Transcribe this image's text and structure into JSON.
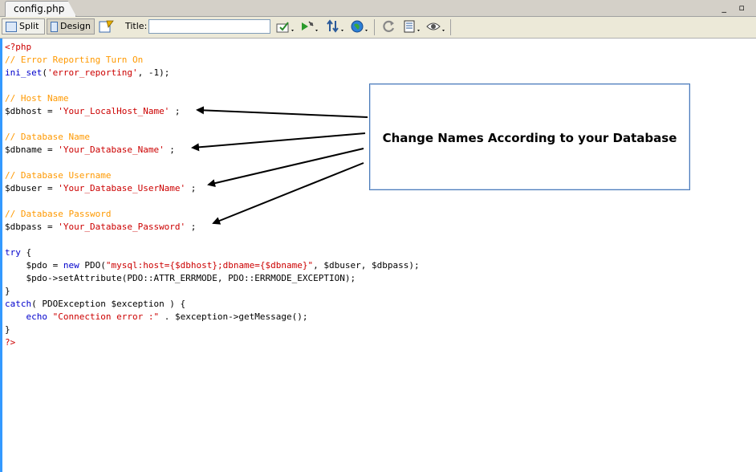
{
  "tab": {
    "label": "config.php"
  },
  "window_controls": "_ ▫",
  "toolbar": {
    "split_label": "Split",
    "design_label": "Design",
    "title_label": "Title:",
    "title_value": ""
  },
  "code_lines": [
    [
      {
        "t": "<?php",
        "c": "tag"
      }
    ],
    [
      {
        "t": "// Error Reporting Turn On",
        "c": "cmt"
      }
    ],
    [
      {
        "t": "ini_set",
        "c": "fn"
      },
      {
        "t": "(",
        "c": "plain"
      },
      {
        "t": "'error_reporting'",
        "c": "str"
      },
      {
        "t": ", -1);",
        "c": "plain"
      }
    ],
    [],
    [
      {
        "t": "// Host Name",
        "c": "cmt"
      }
    ],
    [
      {
        "t": "$dbhost",
        "c": "var"
      },
      {
        "t": " = ",
        "c": "plain"
      },
      {
        "t": "'Your_LocalHost_Name'",
        "c": "str"
      },
      {
        "t": " ;",
        "c": "plain"
      }
    ],
    [],
    [
      {
        "t": "// Database Name",
        "c": "cmt"
      }
    ],
    [
      {
        "t": "$dbname",
        "c": "var"
      },
      {
        "t": " = ",
        "c": "plain"
      },
      {
        "t": "'Your_Database_Name'",
        "c": "str"
      },
      {
        "t": " ;",
        "c": "plain"
      }
    ],
    [],
    [
      {
        "t": "// Database Username",
        "c": "cmt"
      }
    ],
    [
      {
        "t": "$dbuser",
        "c": "var"
      },
      {
        "t": " = ",
        "c": "plain"
      },
      {
        "t": "'Your_Database_UserName'",
        "c": "str"
      },
      {
        "t": " ;",
        "c": "plain"
      }
    ],
    [],
    [
      {
        "t": "// Database Password",
        "c": "cmt"
      }
    ],
    [
      {
        "t": "$dbpass",
        "c": "var"
      },
      {
        "t": " = ",
        "c": "plain"
      },
      {
        "t": "'Your_Database_Password'",
        "c": "str"
      },
      {
        "t": " ;",
        "c": "plain"
      }
    ],
    [],
    [
      {
        "t": "try",
        "c": "kw"
      },
      {
        "t": " {",
        "c": "plain"
      }
    ],
    [
      {
        "t": "    ",
        "c": "plain"
      },
      {
        "t": "$pdo",
        "c": "var"
      },
      {
        "t": " = ",
        "c": "plain"
      },
      {
        "t": "new",
        "c": "kw"
      },
      {
        "t": " PDO(",
        "c": "plain"
      },
      {
        "t": "\"mysql:host={$dbhost};dbname={$dbname}\"",
        "c": "str"
      },
      {
        "t": ", $dbuser, $dbpass);",
        "c": "plain"
      }
    ],
    [
      {
        "t": "    ",
        "c": "plain"
      },
      {
        "t": "$pdo->setAttribute(PDO::ATTR_ERRMODE, PDO::ERRMODE_EXCEPTION);",
        "c": "plain"
      }
    ],
    [
      {
        "t": "}",
        "c": "plain"
      }
    ],
    [
      {
        "t": "catch",
        "c": "kw"
      },
      {
        "t": "( PDOException $exception ) {",
        "c": "plain"
      }
    ],
    [
      {
        "t": "    ",
        "c": "plain"
      },
      {
        "t": "echo",
        "c": "kw"
      },
      {
        "t": " ",
        "c": "plain"
      },
      {
        "t": "\"Connection error :\"",
        "c": "str"
      },
      {
        "t": " . $exception->getMessage();",
        "c": "plain"
      }
    ],
    [
      {
        "t": "}",
        "c": "plain"
      }
    ],
    [
      {
        "t": "?>",
        "c": "tag"
      }
    ]
  ],
  "callout": {
    "text": "Change Names According to your Database"
  }
}
